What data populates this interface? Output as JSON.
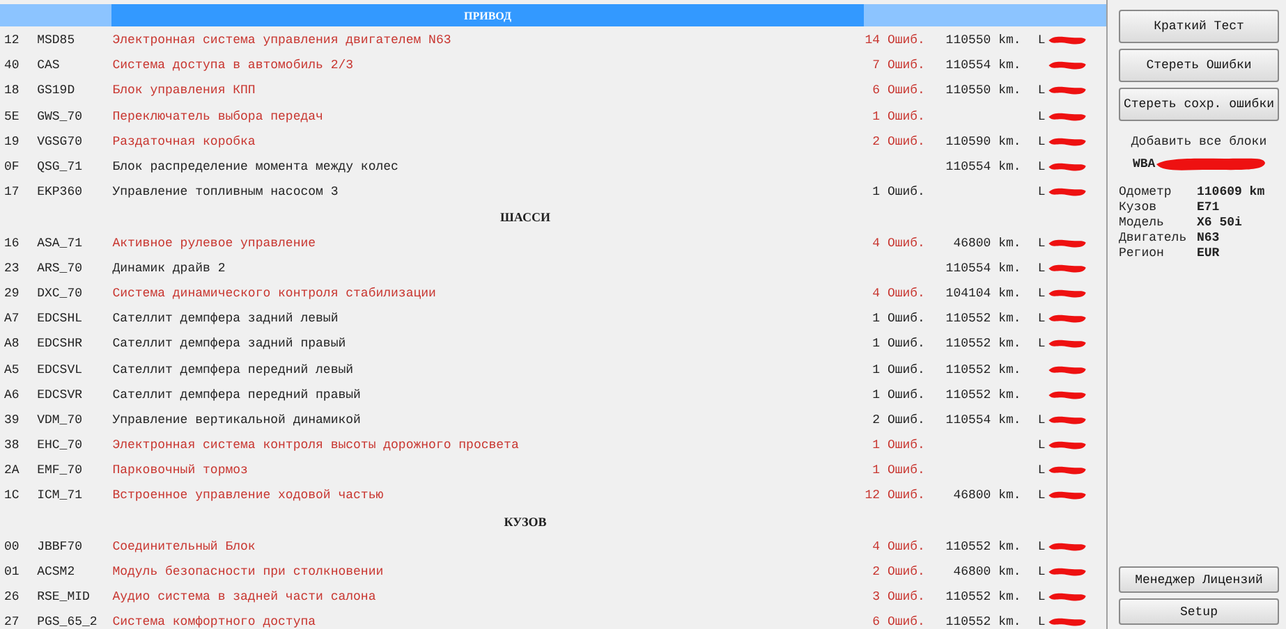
{
  "modules": [
    {
      "kind": "header",
      "title": "ПРИВОД"
    },
    {
      "kind": "row",
      "address": "12",
      "code": "MSD85",
      "name": "Электронная система управления двигателем N63",
      "errors": "14 Ошиб.",
      "mileage": "110550 km.",
      "faulty": true,
      "tail": "L"
    },
    {
      "kind": "row",
      "address": "40",
      "code": "CAS",
      "name": "Система доступа в автомобиль 2/3",
      "errors": "7 Ошиб.",
      "mileage": "110554 km.",
      "faulty": true
    },
    {
      "kind": "row",
      "address": "18",
      "code": "GS19D",
      "name": "Блок управления КПП",
      "errors": "6 Ошиб.",
      "mileage": "110550 km.",
      "faulty": true,
      "tail": "L"
    },
    {
      "kind": "row",
      "address": "5E",
      "code": "GWS_70",
      "name": "Переключатель выбора передач",
      "errors": "1 Ошиб.",
      "faulty": true,
      "tail": "L"
    },
    {
      "kind": "row",
      "address": "19",
      "code": "VGSG70",
      "name": "Раздаточная коробка",
      "errors": "2 Ошиб.",
      "mileage": "110590 km.",
      "faulty": true,
      "tail": "L"
    },
    {
      "kind": "row",
      "address": "0F",
      "code": "QSG_71",
      "name": "Блок распределение момента между колес",
      "mileage": "110554 km.",
      "faulty": false,
      "tail": "L"
    },
    {
      "kind": "row",
      "address": "17",
      "code": "EKP360",
      "name": "Управление топливным насосом 3",
      "errors": "1 Ошиб.",
      "faulty": false,
      "tail": "L"
    },
    {
      "kind": "section",
      "title": "ШАССИ"
    },
    {
      "kind": "row",
      "address": "16",
      "code": "ASA_71",
      "name": "Активное рулевое управление",
      "errors": "4 Ошиб.",
      "mileage": "46800 km.",
      "faulty": true,
      "tail": "L"
    },
    {
      "kind": "row",
      "address": "23",
      "code": "ARS_70",
      "name": "Динамик драйв 2",
      "mileage": "110554 km.",
      "faulty": false,
      "tail": "L"
    },
    {
      "kind": "row",
      "address": "29",
      "code": "DXC_70",
      "name": "Система динамического контроля стабилизации",
      "errors": "4 Ошиб.",
      "mileage": "104104 km.",
      "faulty": true,
      "tail": "L"
    },
    {
      "kind": "row",
      "address": "A7",
      "code": "EDCSHL",
      "name": "Сателлит демпфера задний левый",
      "errors": "1 Ошиб.",
      "mileage": "110552 km.",
      "faulty": false,
      "tail": "L"
    },
    {
      "kind": "row",
      "address": "A8",
      "code": "EDCSHR",
      "name": "Сателлит демпфера задний правый",
      "errors": "1 Ошиб.",
      "mileage": "110552 km.",
      "faulty": false,
      "tail": "L"
    },
    {
      "kind": "row",
      "address": "A5",
      "code": "EDCSVL",
      "name": "Сателлит демпфера передний левый",
      "errors": "1 Ошиб.",
      "mileage": "110552 km.",
      "faulty": false
    },
    {
      "kind": "row",
      "address": "A6",
      "code": "EDCSVR",
      "name": "Сателлит демпфера передний правый",
      "errors": "1 Ошиб.",
      "mileage": "110552 km.",
      "faulty": false
    },
    {
      "kind": "row",
      "address": "39",
      "code": "VDM_70",
      "name": "Управление вертикальной динамикой",
      "errors": "2 Ошиб.",
      "mileage": "110554 km.",
      "faulty": false,
      "tail": "L"
    },
    {
      "kind": "row",
      "address": "38",
      "code": "EHC_70",
      "name": "Электронная система контроля высоты дорожного просвета",
      "errors": "1 Ошиб.",
      "faulty": true,
      "tail": "L"
    },
    {
      "kind": "row",
      "address": "2A",
      "code": "EMF_70",
      "name": "Парковочный тормоз",
      "errors": "1 Ошиб.",
      "faulty": true,
      "tail": "L"
    },
    {
      "kind": "row",
      "address": "1C",
      "code": "ICM_71",
      "name": "Встроенное управление ходовой частью",
      "errors": "12 Ошиб.",
      "mileage": "46800 km.",
      "faulty": true,
      "tail": "L"
    },
    {
      "kind": "section",
      "title": "КУЗОВ"
    },
    {
      "kind": "row",
      "address": "00",
      "code": "JBBF70",
      "name": "Соединительный Блок",
      "errors": "4 Ошиб.",
      "mileage": "110552 km.",
      "faulty": true,
      "tail": "L"
    },
    {
      "kind": "row",
      "address": "01",
      "code": "ACSM2",
      "name": "Модуль безопасности при столкновении",
      "errors": "2 Ошиб.",
      "mileage": "46800 km.",
      "faulty": true,
      "tail": "L"
    },
    {
      "kind": "row",
      "address": "26",
      "code": "RSE_MID",
      "name": "Аудио система в задней части салона",
      "errors": "3 Ошиб.",
      "mileage": "110552 km.",
      "faulty": true,
      "tail": "L"
    },
    {
      "kind": "row",
      "address": "27",
      "code": "PGS_65_2",
      "name": "Система комфортного доступа",
      "errors": "6 Ошиб.",
      "mileage": "110552 km.",
      "faulty": true,
      "tail": "L"
    }
  ],
  "sidebar": {
    "buttons_top": [
      "Краткий Тест",
      "Стереть Ошибки",
      "Стереть сохр. ошибки"
    ],
    "add_all": "Добавить все блоки",
    "vin": "WBA",
    "info": [
      {
        "label": "Одометр",
        "value": "110609 km"
      },
      {
        "label": "Кузов",
        "value": "E71"
      },
      {
        "label": "Модель",
        "value": "X6 50i"
      },
      {
        "label": "Двигатель",
        "value": "N63"
      },
      {
        "label": "Регион",
        "value": "EUR"
      }
    ],
    "buttons_bottom": [
      "Менеджер Лицензий",
      "Setup"
    ]
  }
}
